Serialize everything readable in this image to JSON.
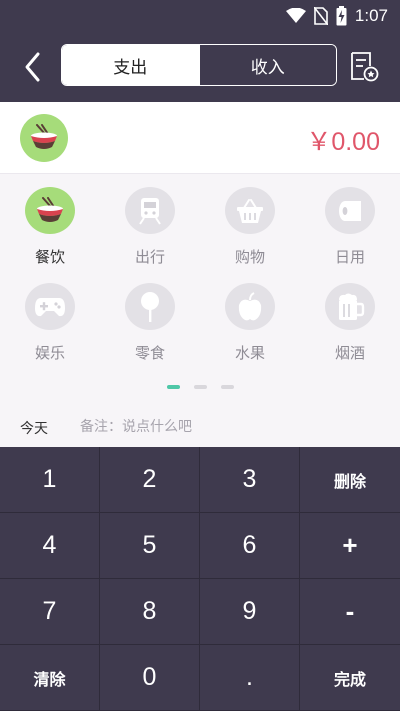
{
  "status_bar": {
    "time": "1:07",
    "icons": [
      "wifi-icon",
      "no-sim-icon",
      "battery-charging-icon"
    ]
  },
  "header": {
    "back_icon": "chevron-left-icon",
    "tabs": [
      {
        "label": "支出",
        "active": true
      },
      {
        "label": "收入",
        "active": false
      }
    ],
    "bill_icon": "bill-settings-icon"
  },
  "amount": {
    "category_icon": "rice-bowl-icon",
    "value": "￥0.00",
    "color": "#e0566a"
  },
  "categories": [
    {
      "label": "餐饮",
      "icon": "rice-bowl-icon",
      "active": true
    },
    {
      "label": "出行",
      "icon": "train-icon",
      "active": false
    },
    {
      "label": "购物",
      "icon": "basket-icon",
      "active": false
    },
    {
      "label": "日用",
      "icon": "tissue-roll-icon",
      "active": false
    },
    {
      "label": "娱乐",
      "icon": "gamepad-icon",
      "active": false
    },
    {
      "label": "零食",
      "icon": "lollipop-icon",
      "active": false
    },
    {
      "label": "水果",
      "icon": "apple-icon",
      "active": false
    },
    {
      "label": "烟酒",
      "icon": "beer-mug-icon",
      "active": false
    }
  ],
  "pagination": {
    "pages": 3,
    "current": 1
  },
  "note": {
    "date_label": "今天",
    "placeholder": "备注：说点什么吧"
  },
  "keypad": {
    "keys": [
      "1",
      "2",
      "3",
      "删除",
      "4",
      "5",
      "6",
      "+",
      "7",
      "8",
      "9",
      "-",
      "清除",
      "0",
      ".",
      "完成"
    ]
  },
  "colors": {
    "dark": "#3f3a4e",
    "accent_green": "#a6dc7a",
    "accent_teal": "#4fc7a7",
    "amount_red": "#e0566a"
  }
}
